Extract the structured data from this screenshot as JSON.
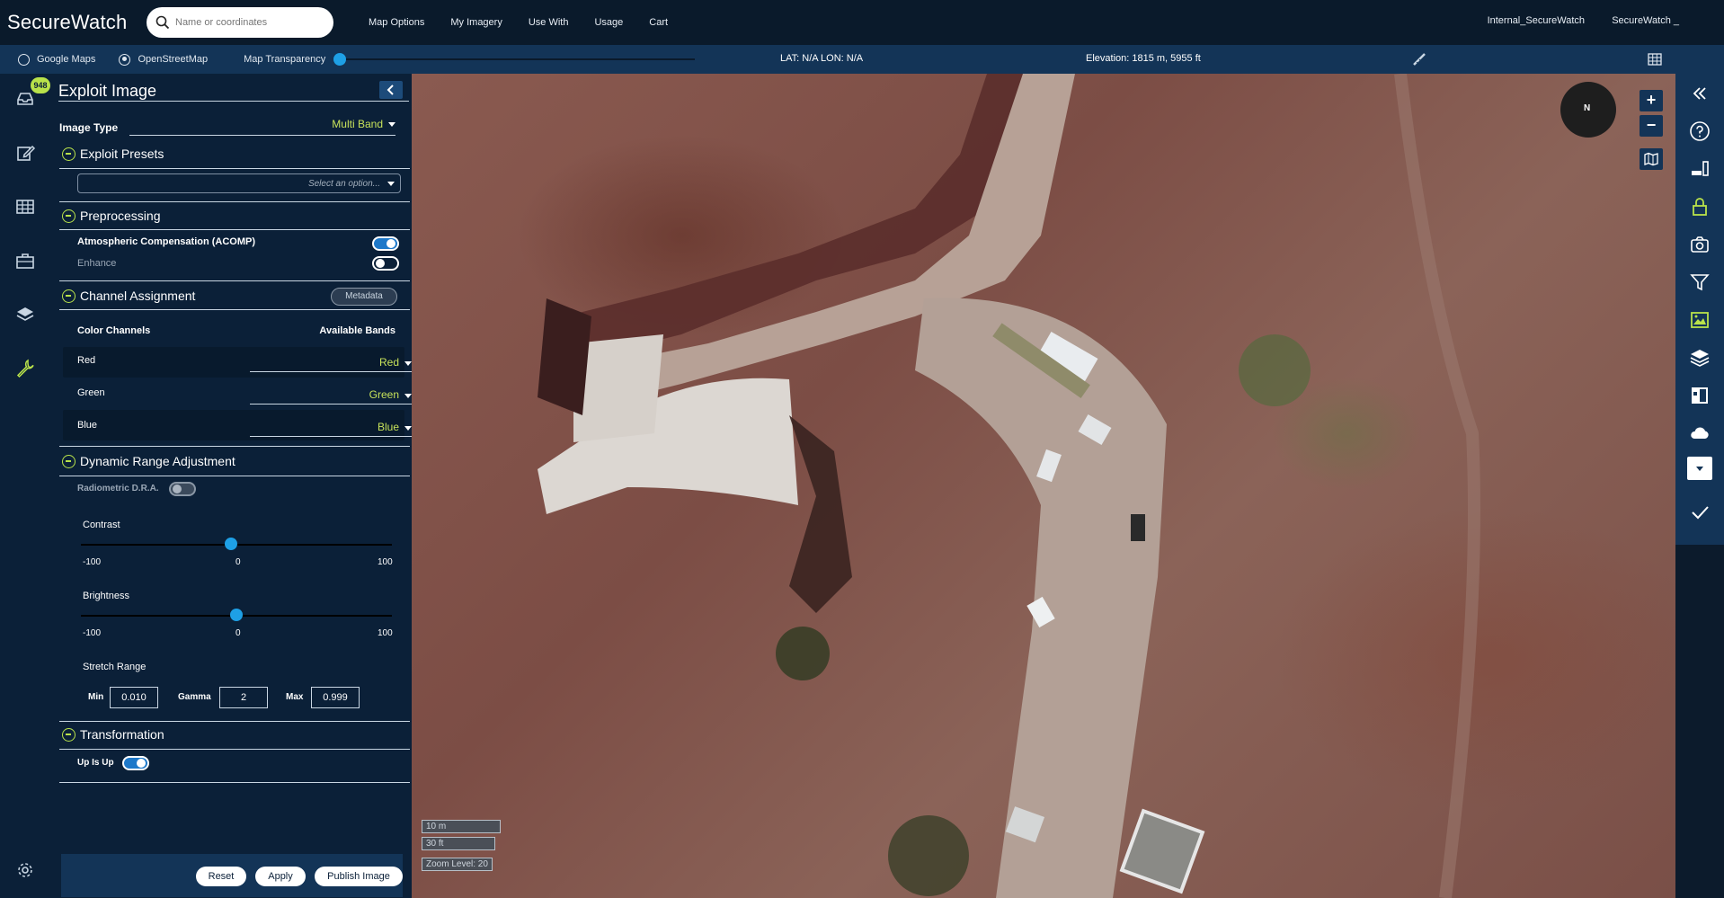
{
  "app": {
    "brand": "SecureWatch"
  },
  "search": {
    "placeholder": "Name or coordinates"
  },
  "nav": {
    "items": [
      "Map Options",
      "My Imagery",
      "Use With",
      "Usage",
      "Cart"
    ]
  },
  "user": {
    "account": "Internal_SecureWatch",
    "menu": "SecureWatch _"
  },
  "basemap": {
    "google": "Google Maps",
    "osm": "OpenStreetMap",
    "transparency": "Map Transparency",
    "selected": "OpenStreetMap",
    "transparency_value": 0
  },
  "status": {
    "coords": "LAT: N/A LON: N/A",
    "elevation": "Elevation: 1815 m, 5955 ft"
  },
  "leftnav": {
    "badge": "948"
  },
  "panel": {
    "title": "Exploit Image",
    "image_type_label": "Image Type",
    "image_type_value": "Multi Band",
    "presets": {
      "title": "Exploit Presets",
      "placeholder": "Select an option..."
    },
    "preprocessing": {
      "title": "Preprocessing",
      "acomp_label": "Atmospheric Compensation (ACOMP)",
      "acomp_on": true,
      "enhance_label": "Enhance",
      "enhance_on": false
    },
    "channels": {
      "title": "Channel Assignment",
      "metadata_button": "Metadata",
      "col1": "Color Channels",
      "col2": "Available Bands",
      "rows": [
        {
          "label": "Red",
          "value": "Red"
        },
        {
          "label": "Green",
          "value": "Green"
        },
        {
          "label": "Blue",
          "value": "Blue"
        }
      ]
    },
    "dra": {
      "title": "Dynamic Range Adjustment",
      "radiometric_label": "Radiometric D.R.A.",
      "radiometric_on": false,
      "contrast": {
        "label": "Contrast",
        "min": "-100",
        "mid": "0",
        "max": "100",
        "value": 0
      },
      "brightness": {
        "label": "Brightness",
        "min": "-100",
        "mid": "0",
        "max": "100",
        "value": 0
      },
      "stretch": {
        "label": "Stretch Range",
        "min_label": "Min",
        "min_value": "0.010",
        "gamma_label": "Gamma",
        "gamma_value": "2",
        "max_label": "Max",
        "max_value": "0.999"
      }
    },
    "transformation": {
      "title": "Transformation",
      "upisup_label": "Up Is Up",
      "upisup_on": true
    },
    "footer": {
      "reset": "Reset",
      "apply": "Apply",
      "publish": "Publish Image"
    }
  },
  "map": {
    "compass": "N",
    "zoom_in": "+",
    "zoom_out": "−",
    "scale_m": "10 m",
    "scale_ft": "30 ft",
    "zoom_level": "Zoom Level: 20"
  },
  "colors": {
    "accent": "#1ea0e6",
    "lime": "#b9e24a",
    "panel_bg": "#0b2038",
    "bar_bg": "#133457"
  }
}
